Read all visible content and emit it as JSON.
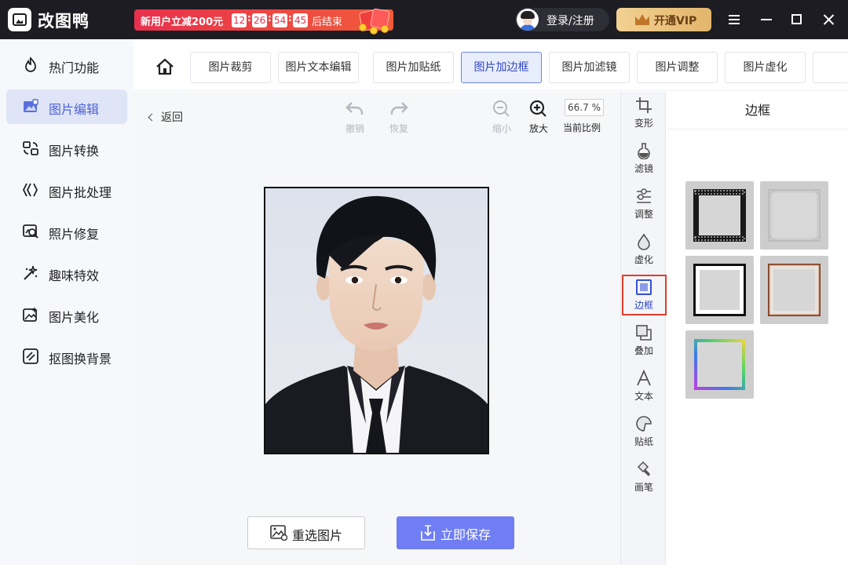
{
  "app": {
    "name": "改图鸭"
  },
  "promo": {
    "text": "新用户立减200元",
    "countdown": [
      "12",
      "26",
      "54",
      "45"
    ],
    "suffix": "后结束"
  },
  "header": {
    "login_label": "登录/注册",
    "vip_label": "开通VIP"
  },
  "sidebar": {
    "items": [
      {
        "label": "热门功能",
        "icon": "fire-icon"
      },
      {
        "label": "图片编辑",
        "icon": "image-edit-icon",
        "active": true
      },
      {
        "label": "图片转换",
        "icon": "convert-icon"
      },
      {
        "label": "图片批处理",
        "icon": "batch-icon"
      },
      {
        "label": "照片修复",
        "icon": "repair-icon"
      },
      {
        "label": "趣味特效",
        "icon": "magic-icon"
      },
      {
        "label": "图片美化",
        "icon": "beautify-icon"
      },
      {
        "label": "抠图换背景",
        "icon": "cutout-icon"
      }
    ]
  },
  "tabs": [
    {
      "label": "图片裁剪"
    },
    {
      "label": "图片文本编辑"
    },
    {
      "label": "图片加贴纸"
    },
    {
      "label": "图片加边框",
      "active": true
    },
    {
      "label": "图片加滤镜"
    },
    {
      "label": "图片调整"
    },
    {
      "label": "图片虚化"
    }
  ],
  "toolbar": {
    "back_label": "返回",
    "undo_label": "撤销",
    "redo_label": "恢复",
    "zoom_out_label": "缩小",
    "zoom_in_label": "放大",
    "zoom_value": "66.7 %",
    "zoom_caption": "当前比例"
  },
  "actions": {
    "reselect_label": "重选图片",
    "save_label": "立即保存"
  },
  "tool_column": [
    {
      "label": "变形",
      "icon": "transform-icon"
    },
    {
      "label": "滤镜",
      "icon": "filter-icon"
    },
    {
      "label": "调整",
      "icon": "adjust-icon"
    },
    {
      "label": "虚化",
      "icon": "blur-icon"
    },
    {
      "label": "边框",
      "icon": "frame-icon",
      "active": true
    },
    {
      "label": "叠加",
      "icon": "overlay-icon"
    },
    {
      "label": "文本",
      "icon": "text-icon"
    },
    {
      "label": "贴纸",
      "icon": "sticker-icon"
    },
    {
      "label": "画笔",
      "icon": "brush-icon"
    }
  ],
  "panel": {
    "title": "边框"
  },
  "colors": {
    "accent": "#6f7ef3",
    "titlebar": "#1c1c22",
    "promo": "#e8304c",
    "highlight": "#e23c2c"
  }
}
